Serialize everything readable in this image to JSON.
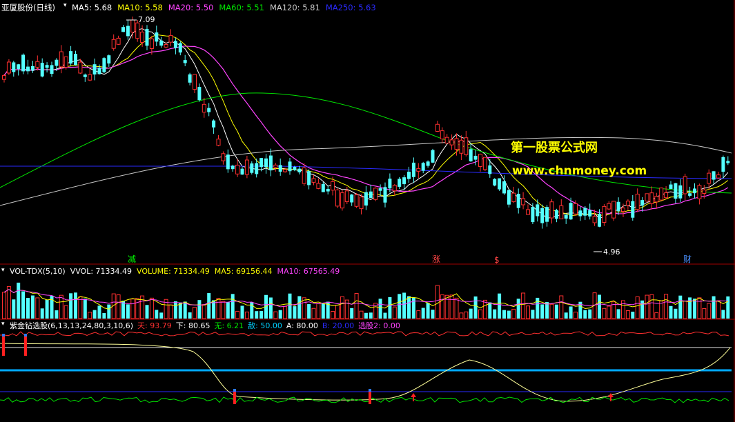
{
  "main_panel": {
    "stock_title": "亚厦股份(日线)",
    "indicators": [
      {
        "label": "MA5: 5.68",
        "color": "#ffffff"
      },
      {
        "label": "MA10: 5.58",
        "color": "#ffff00"
      },
      {
        "label": "MA20: 5.50",
        "color": "#ff44ff"
      },
      {
        "label": "MA60: 5.51",
        "color": "#00e600"
      },
      {
        "label": "MA120: 5.81",
        "color": "#c8c8c8"
      },
      {
        "label": "MA250: 5.63",
        "color": "#2a2aff"
      }
    ],
    "high_label": "7.09",
    "low_label": "4.96",
    "watermark_title": "第一股票公式网",
    "watermark_url": "www.chnmoney.com",
    "event_markers": [
      {
        "text": "减",
        "color": "#00ff00"
      },
      {
        "text": "涨",
        "color": "#ff4444"
      },
      {
        "text": "$",
        "color": "#ff4444"
      },
      {
        "text": "财",
        "color": "#4a90ff"
      }
    ]
  },
  "volume_panel": {
    "indicators": [
      {
        "label": "VOL-TDX(5,10)",
        "color": "#ffffff"
      },
      {
        "label": "VVOL: 71334.49",
        "color": "#ffffff"
      },
      {
        "label": "VOLUME: 71334.49",
        "color": "#ffff00"
      },
      {
        "label": "MA5: 69156.44",
        "color": "#ffff00"
      },
      {
        "label": "MA10: 67565.49",
        "color": "#ff44ff"
      }
    ]
  },
  "signal_panel": {
    "indicators": [
      {
        "label": "紫金钻选股(6,13,13,24,80,3,10,6)",
        "color": "#ffffff"
      },
      {
        "label": "天: 93.79",
        "color": "#ff3030"
      },
      {
        "label": "下: 80.65",
        "color": "#ffffff"
      },
      {
        "label": "无: 6.21",
        "color": "#00e600"
      },
      {
        "label": "敌: 50.00",
        "color": "#00d0ff"
      },
      {
        "label": "A: 80.00",
        "color": "#ffffff"
      },
      {
        "label": "B: 20.00",
        "color": "#2a2aff"
      },
      {
        "label": "选股2: 0.00",
        "color": "#ff44ff"
      }
    ]
  },
  "colors": {
    "up": "#ff3030",
    "down": "#54ffff",
    "panel_border": "#a00000"
  }
}
